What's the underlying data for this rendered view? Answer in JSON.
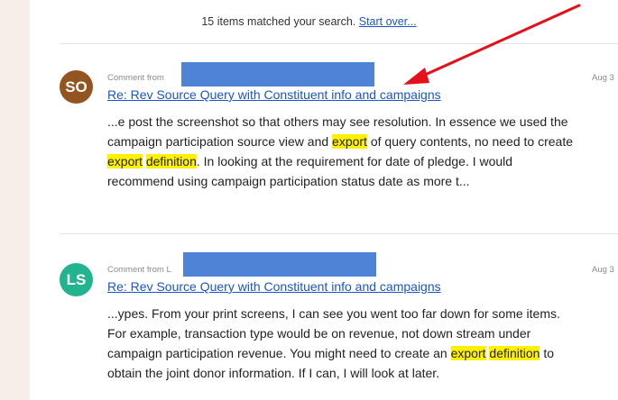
{
  "search": {
    "summary_text": "15 items matched your search.",
    "start_over_label": "Start over..."
  },
  "results": [
    {
      "avatar_initials": "SO",
      "avatar_color": "#94541f",
      "comment_from_label": "Comment from",
      "title": "Re: Rev Source Query with Constituent info and campaigns",
      "date": "Aug 3",
      "excerpt_segments": [
        {
          "text": "...e post the screenshot so that others may see resolution. In essence we used the campaign participation source view and ",
          "highlight": false
        },
        {
          "text": "export",
          "highlight": true
        },
        {
          "text": " of query contents, no need to create ",
          "highlight": false
        },
        {
          "text": "export",
          "highlight": true
        },
        {
          "text": " ",
          "highlight": false
        },
        {
          "text": "definition",
          "highlight": true
        },
        {
          "text": ". In looking at the requirement for date of pledge. I would recommend using campaign participation status date as more t...",
          "highlight": false
        }
      ]
    },
    {
      "avatar_initials": "LS",
      "avatar_color": "#22b48e",
      "comment_from_label": "Comment from L",
      "title": "Re: Rev Source Query with Constituent info and campaigns",
      "date": "Aug 3",
      "excerpt_segments": [
        {
          "text": "...ypes. From your print screens, I can see you went too far down for some items. For example, transaction type would be on revenue, not down stream under campaign participation revenue. You might need to create an ",
          "highlight": false
        },
        {
          "text": "export",
          "highlight": true
        },
        {
          "text": " ",
          "highlight": false
        },
        {
          "text": "definition",
          "highlight": true
        },
        {
          "text": " to obtain the joint donor information. If I can, I will look at later.",
          "highlight": false
        }
      ]
    }
  ],
  "colors": {
    "link": "#1a55c9",
    "highlight": "#fff200",
    "redaction": "#4f83d6",
    "annotation_arrow": "#e5101a"
  }
}
